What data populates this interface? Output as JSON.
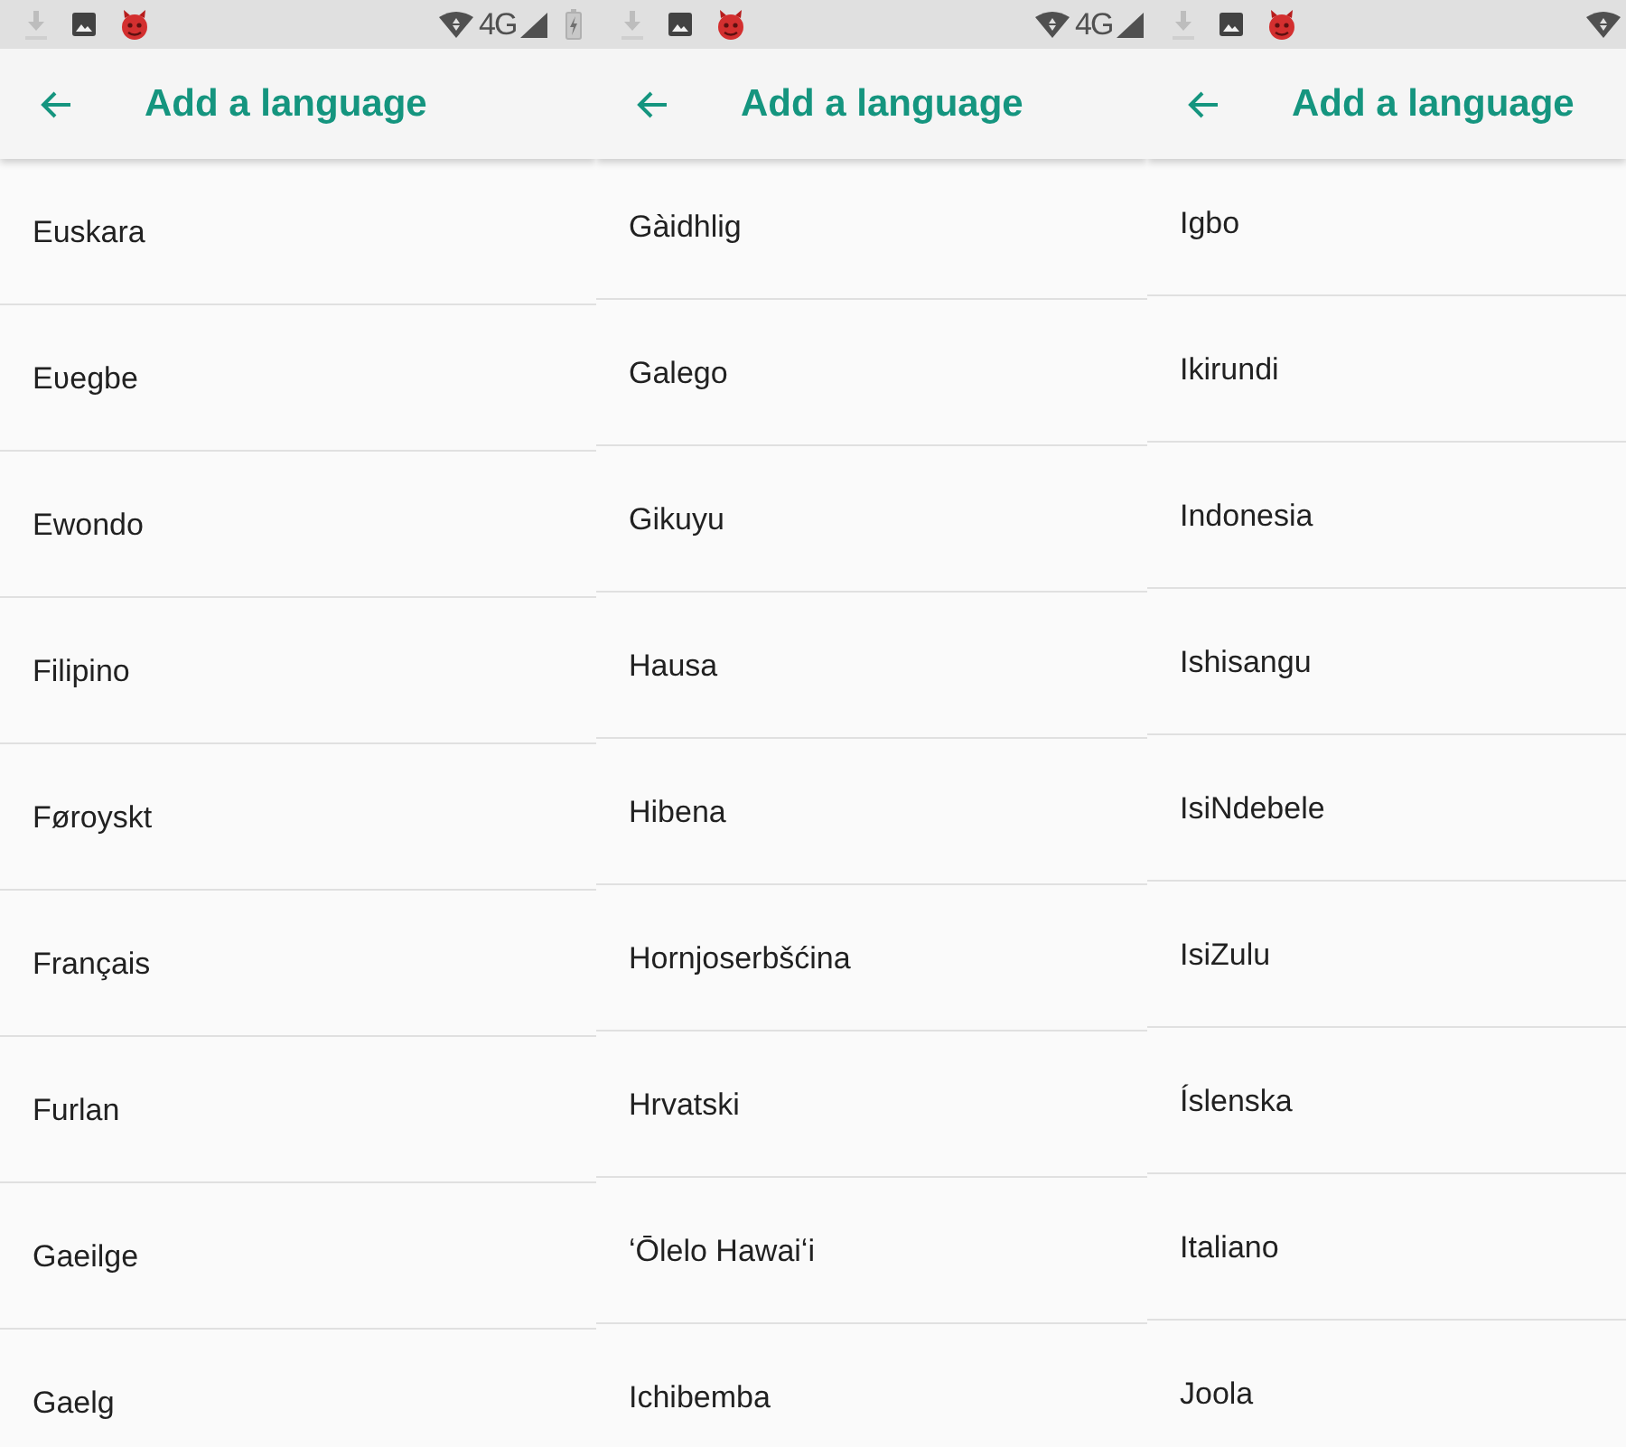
{
  "panels": [
    {
      "status_bar": {
        "network": "4G"
      },
      "app_bar": {
        "title": "Add a language"
      },
      "languages": [
        "Euskara",
        "Eʋegbe",
        "Ewondo",
        "Filipino",
        "Føroyskt",
        "Français",
        "Furlan",
        "Gaeilge",
        "Gaelg"
      ]
    },
    {
      "status_bar": {
        "network": "4G"
      },
      "app_bar": {
        "title": "Add a language"
      },
      "languages": [
        "Gàidhlig",
        "Galego",
        "Gikuyu",
        "Hausa",
        "Hibena",
        "Hornjoserbšćina",
        "Hrvatski",
        "ʻŌlelo Hawaiʻi",
        "Ichibemba"
      ]
    },
    {
      "app_bar": {
        "title": "Add a language"
      },
      "languages": [
        "Igbo",
        "Ikirundi",
        "Indonesia",
        "Ishisangu",
        "IsiNdebele",
        "IsiZulu",
        "Íslenska",
        "Italiano",
        "Joola"
      ]
    }
  ]
}
